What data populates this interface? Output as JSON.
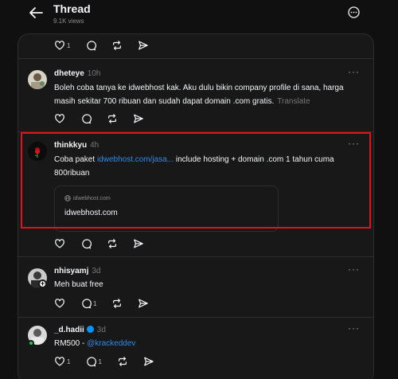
{
  "header": {
    "title": "Thread",
    "views": "9.1K views"
  },
  "top_actions": {
    "like_count": "1"
  },
  "posts": [
    {
      "username": "dheteye",
      "time": "10h",
      "text": "Boleh coba tanya ke idwebhost kak. Aku dulu bikin company profile di sana, harga masih sekitar 700 ribuan dan sudah dapat domain .com gratis.",
      "translate": "Translate"
    },
    {
      "username": "thinkkyu",
      "time": "4h",
      "text_prefix": "Coba paket ",
      "link": "idwebhost.com/jasa...",
      "text_suffix": " include hosting + domain .com 1 tahun cuma 800ribuan",
      "card_domain": "idwebhost.com",
      "card_title": "idwebhost.com"
    },
    {
      "username": "nhisyamj",
      "time": "3d",
      "text": "Meh buat free",
      "reply_count": "1"
    },
    {
      "username": "_d.hadii",
      "time": "3d",
      "text_prefix": "RM500 - ",
      "mention": "@krackeddev",
      "like_count": "1",
      "reply_count": "1"
    }
  ],
  "colors": {
    "background": "#101010",
    "panel": "#181818",
    "link": "#2f8ae5",
    "highlight": "#e5101d",
    "verified": "#0095f6"
  }
}
